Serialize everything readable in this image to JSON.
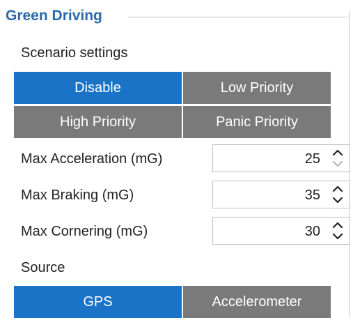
{
  "group": {
    "title": "Green Driving"
  },
  "scenario": {
    "label": "Scenario settings",
    "options": [
      {
        "label": "Disable",
        "active": true
      },
      {
        "label": "Low Priority",
        "active": false
      },
      {
        "label": "High Priority",
        "active": false
      },
      {
        "label": "Panic Priority",
        "active": false
      }
    ]
  },
  "fields": [
    {
      "label": "Max Acceleration (mG)",
      "value": "25",
      "down_disabled": true
    },
    {
      "label": "Max Braking (mG)",
      "value": "35",
      "down_disabled": false
    },
    {
      "label": "Max Cornering (mG)",
      "value": "30",
      "down_disabled": false
    }
  ],
  "source": {
    "label": "Source",
    "options": [
      {
        "label": "GPS",
        "active": true
      },
      {
        "label": "Accelerometer",
        "active": false
      }
    ]
  },
  "colors": {
    "title": "#2a6aa8",
    "active_button": "#1a73c6",
    "inactive_button": "#7a7a7a"
  },
  "icons": {
    "spin_up": "chevron-up-icon",
    "spin_down": "chevron-down-icon"
  }
}
